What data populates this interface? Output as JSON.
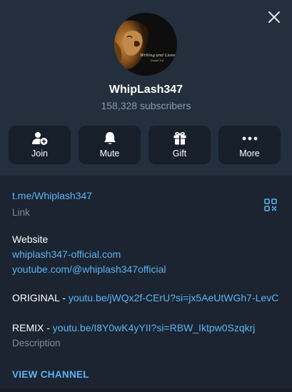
{
  "channel": {
    "name": "WhipLash347",
    "subscribers": "158,328 subscribers",
    "avatar_caption": "Writing and Lions",
    "avatar_sub": "Daniel 6:6"
  },
  "actions": [
    {
      "label": "Join",
      "icon": "add-user-icon"
    },
    {
      "label": "Mute",
      "icon": "bell-icon"
    },
    {
      "label": "Gift",
      "icon": "gift-icon"
    },
    {
      "label": "More",
      "icon": "more-dots-icon"
    }
  ],
  "info": {
    "link": "t.me/Whiplash347",
    "link_caption": "Link",
    "website_heading": "Website",
    "website_url": "whiplash347-official.com",
    "youtube_url": "youtube.com/@whiplash347official",
    "original_label": "ORIGINAL - ",
    "original_url": "youtu.be/jWQx2f-CErU?si=jx5AeUtWGh7-LevC",
    "remix_label": "REMIX - ",
    "remix_url": "youtu.be/I8Y0wK4yYII?si=RBW_Iktpw0Szqkrj",
    "description_caption": "Description"
  },
  "view_channel": "VIEW CHANNEL",
  "colors": {
    "background": "#1b2430",
    "header": "#232f3d",
    "button": "#161f2a",
    "accent": "#5bb4f4",
    "muted": "#7f8d9b"
  }
}
